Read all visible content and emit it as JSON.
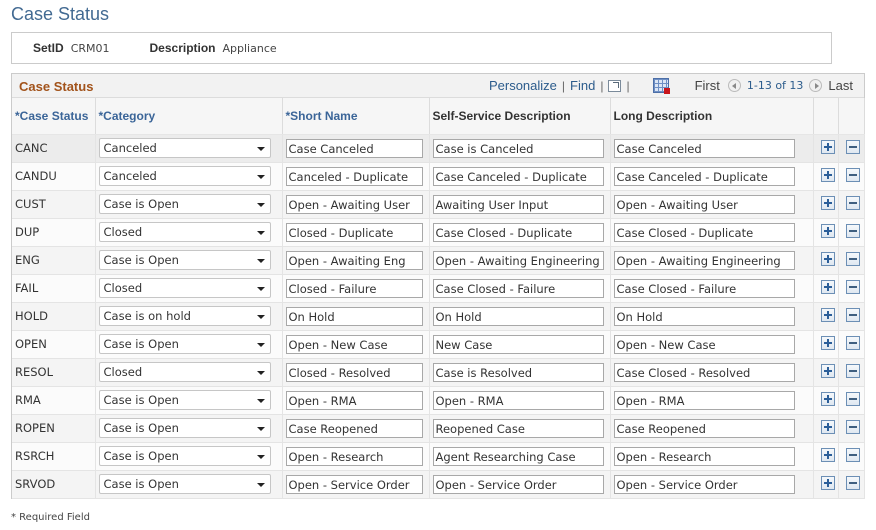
{
  "page": {
    "title": "Case Status"
  },
  "key_fields": {
    "setid_label": "SetID",
    "setid_value": "CRM01",
    "description_label": "Description",
    "description_value": "Appliance"
  },
  "grid": {
    "title": "Case Status",
    "toolbar": {
      "personalize": "Personalize",
      "find": "Find",
      "separator": "|",
      "first": "First",
      "range": "1-13 of 13",
      "last": "Last",
      "icons": [
        "zoom-view-icon",
        "download-spreadsheet-icon",
        "previous-icon",
        "next-icon"
      ]
    },
    "columns": [
      {
        "label": "*Case Status",
        "required": true
      },
      {
        "label": "*Category",
        "required": true
      },
      {
        "label": "*Short Name",
        "required": true
      },
      {
        "label": "Self-Service Description",
        "required": false
      },
      {
        "label": "Long Description",
        "required": false
      }
    ],
    "rows": [
      {
        "status": "CANC",
        "category": "Canceled",
        "short_name": "Case Canceled",
        "self_service": "Case is Canceled",
        "long_desc": "Case Canceled"
      },
      {
        "status": "CANDU",
        "category": "Canceled",
        "short_name": "Canceled - Duplicate",
        "self_service": "Case Canceled - Duplicate",
        "long_desc": "Case Canceled - Duplicate"
      },
      {
        "status": "CUST",
        "category": "Case is Open",
        "short_name": "Open - Awaiting User",
        "self_service": "Awaiting User Input",
        "long_desc": "Open - Awaiting User"
      },
      {
        "status": "DUP",
        "category": "Closed",
        "short_name": "Closed - Duplicate",
        "self_service": "Case Closed - Duplicate",
        "long_desc": "Case Closed - Duplicate"
      },
      {
        "status": "ENG",
        "category": "Case is Open",
        "short_name": "Open - Awaiting Eng",
        "self_service": "Open - Awaiting Engineering",
        "long_desc": "Open - Awaiting Engineering"
      },
      {
        "status": "FAIL",
        "category": "Closed",
        "short_name": "Closed - Failure",
        "self_service": "Case Closed - Failure",
        "long_desc": "Case Closed - Failure"
      },
      {
        "status": "HOLD",
        "category": "Case is on hold",
        "short_name": "On Hold",
        "self_service": "On Hold",
        "long_desc": "On Hold"
      },
      {
        "status": "OPEN",
        "category": "Case is Open",
        "short_name": "Open - New Case",
        "self_service": "New Case",
        "long_desc": "Open - New Case"
      },
      {
        "status": "RESOL",
        "category": "Closed",
        "short_name": "Closed - Resolved",
        "self_service": "Case is Resolved",
        "long_desc": "Case Closed - Resolved"
      },
      {
        "status": "RMA",
        "category": "Case is Open",
        "short_name": "Open - RMA",
        "self_service": "Open - RMA",
        "long_desc": "Open - RMA"
      },
      {
        "status": "ROPEN",
        "category": "Case is Open",
        "short_name": "Case Reopened",
        "self_service": "Reopened Case",
        "long_desc": "Case Reopened"
      },
      {
        "status": "RSRCH",
        "category": "Case is Open",
        "short_name": "Open - Research",
        "self_service": "Agent Researching Case",
        "long_desc": "Open - Research"
      },
      {
        "status": "SRVOD",
        "category": "Case is Open",
        "short_name": "Open - Service Order",
        "self_service": "Open - Service Order",
        "long_desc": "Open - Service Order"
      }
    ],
    "row_actions": {
      "add_icon": "plus-icon",
      "delete_icon": "minus-icon"
    }
  },
  "footer": {
    "required_note": "* Required Field"
  },
  "colors": {
    "page_title": "#426a92",
    "grid_title": "#a2531b",
    "link": "#2c5c8c"
  }
}
